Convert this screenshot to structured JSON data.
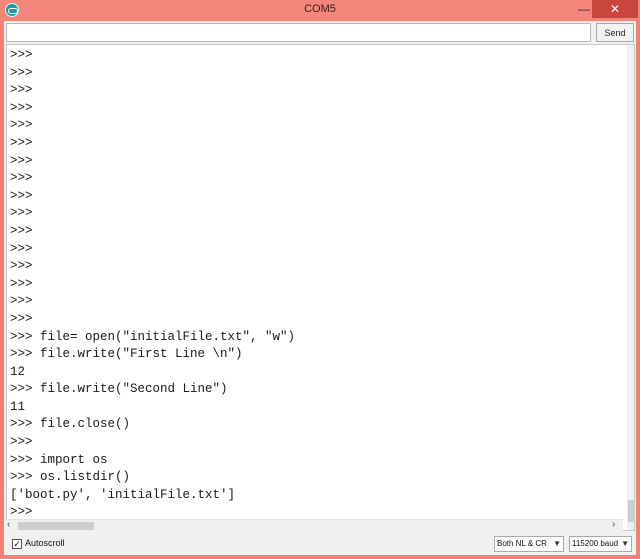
{
  "window": {
    "title": "COM5",
    "minimize": "—",
    "maximize": "□",
    "close": "✕"
  },
  "send_bar": {
    "input_value": "",
    "send_label": "Send"
  },
  "console": {
    "lines": [
      ">>>",
      ">>>",
      ">>>",
      ">>>",
      ">>>",
      ">>>",
      ">>>",
      ">>>",
      ">>>",
      ">>>",
      ">>>",
      ">>>",
      ">>>",
      ">>>",
      ">>>",
      ">>>",
      ">>> file= open(\"initialFile.txt\", \"w\")",
      ">>> file.write(\"First Line \\n\")",
      "12",
      ">>> file.write(\"Second Line\")",
      "11",
      ">>> file.close()",
      ">>>",
      ">>> import os",
      ">>> os.listdir()",
      "['boot.py', 'initialFile.txt']",
      ">>>"
    ]
  },
  "footer": {
    "autoscroll_label": "Autoscroll",
    "autoscroll_checked": true,
    "line_ending_value": "Both NL & CR",
    "baud_value": "115200 baud"
  }
}
